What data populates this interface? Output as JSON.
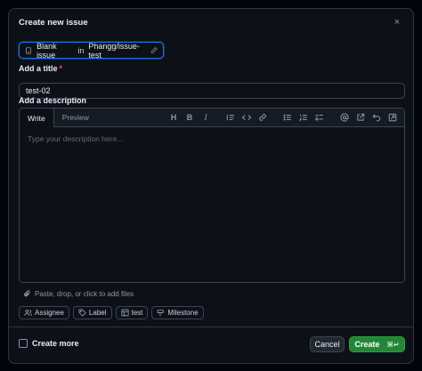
{
  "dialog": {
    "title": "Create new issue",
    "close_glyph": "×"
  },
  "template": {
    "prefix": "Blank issue",
    "connector": "in",
    "repo": "Phangg/issue-test"
  },
  "title_field": {
    "label": "Add a title",
    "required_mark": "*",
    "value": "test-02"
  },
  "description": {
    "label": "Add a description",
    "tabs": [
      {
        "label": "Write",
        "active": true
      },
      {
        "label": "Preview",
        "active": false
      }
    ],
    "toolbar": [
      "heading-icon",
      "bold-icon",
      "italic-icon",
      "quote-icon",
      "code-icon",
      "link-icon",
      "bulleted-list-icon",
      "numbered-list-icon",
      "task-list-icon",
      "mention-icon",
      "reference-icon",
      "undo-icon",
      "fullscreen-icon"
    ],
    "placeholder": "Type your description here..."
  },
  "attach": {
    "text": "Paste, drop, or click to add files"
  },
  "metadata": {
    "assignee": "Assignee",
    "label": "Label",
    "project": "test",
    "milestone": "Milestone"
  },
  "footer": {
    "create_more": "Create more",
    "cancel": "Cancel",
    "create": "Create",
    "create_shortcut": "⌘↵"
  }
}
